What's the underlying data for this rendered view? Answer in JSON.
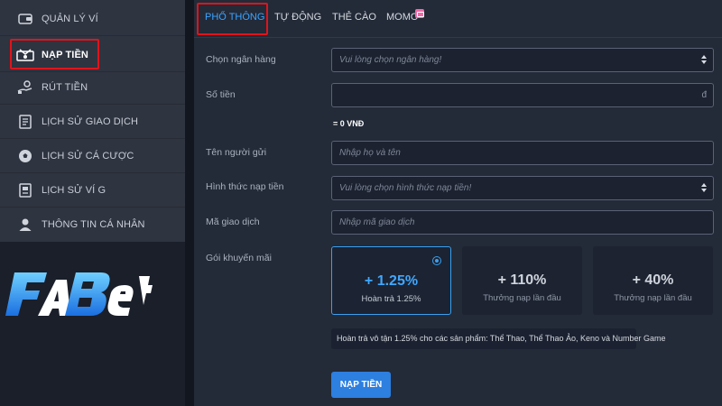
{
  "sidebar": {
    "items": [
      {
        "label": "QUẢN LÝ VÍ",
        "icon": "wallet-icon"
      },
      {
        "label": "NẠP TIỀN",
        "icon": "deposit-icon"
      },
      {
        "label": "RÚT TIỀN",
        "icon": "withdraw-icon"
      },
      {
        "label": "LỊCH SỬ GIAO DỊCH",
        "icon": "transaction-history-icon"
      },
      {
        "label": "LỊCH SỬ CÁ CƯỢC",
        "icon": "soccer-ball-icon"
      },
      {
        "label": "LỊCH SỬ VÍ G",
        "icon": "wallet-history-icon"
      },
      {
        "label": "THÔNG TIN CÁ NHÂN",
        "icon": "user-icon"
      }
    ],
    "active_index": 1
  },
  "brand": {
    "logo_text": "FABET"
  },
  "tabs": [
    {
      "label": "PHỔ THÔNG"
    },
    {
      "label": "TỰ ĐỘNG"
    },
    {
      "label": "THẺ CÀO"
    },
    {
      "label": "MOMO"
    }
  ],
  "form": {
    "bank": {
      "label": "Chọn ngân hàng",
      "placeholder": "Vui lòng chọn ngân hàng!"
    },
    "amount": {
      "label": "Số tiền",
      "currency": "đ",
      "note": "= 0 VNĐ"
    },
    "sender": {
      "label": "Tên người gửi",
      "placeholder": "Nhập họ và tên"
    },
    "method": {
      "label": "Hình thức nạp tiền",
      "placeholder": "Vui lòng chọn hình thức nạp tiền!"
    },
    "txn": {
      "label": "Mã giao dịch",
      "placeholder": "Nhập mã giao dịch"
    },
    "promo": {
      "label": "Gói khuyến mãi",
      "options": [
        {
          "value": "+ 1.25%",
          "desc": "Hoàn trả 1.25%",
          "selected": true
        },
        {
          "value": "+ 110%",
          "desc": "Thưởng nạp lần đầu",
          "selected": false
        },
        {
          "value": "+ 40%",
          "desc": "Thưởng nạp lần đầu",
          "selected": false
        }
      ],
      "info": "Hoàn trả vô tận 1.25% cho các sản phẩm: Thể Thao, Thể Thao Ảo, Keno và Number Game"
    },
    "submit_label": "NẠP TIỀN"
  },
  "colors": {
    "accent": "#2d7fe0",
    "highlight": "#e0141b",
    "active_tab": "#3ba4ff"
  }
}
